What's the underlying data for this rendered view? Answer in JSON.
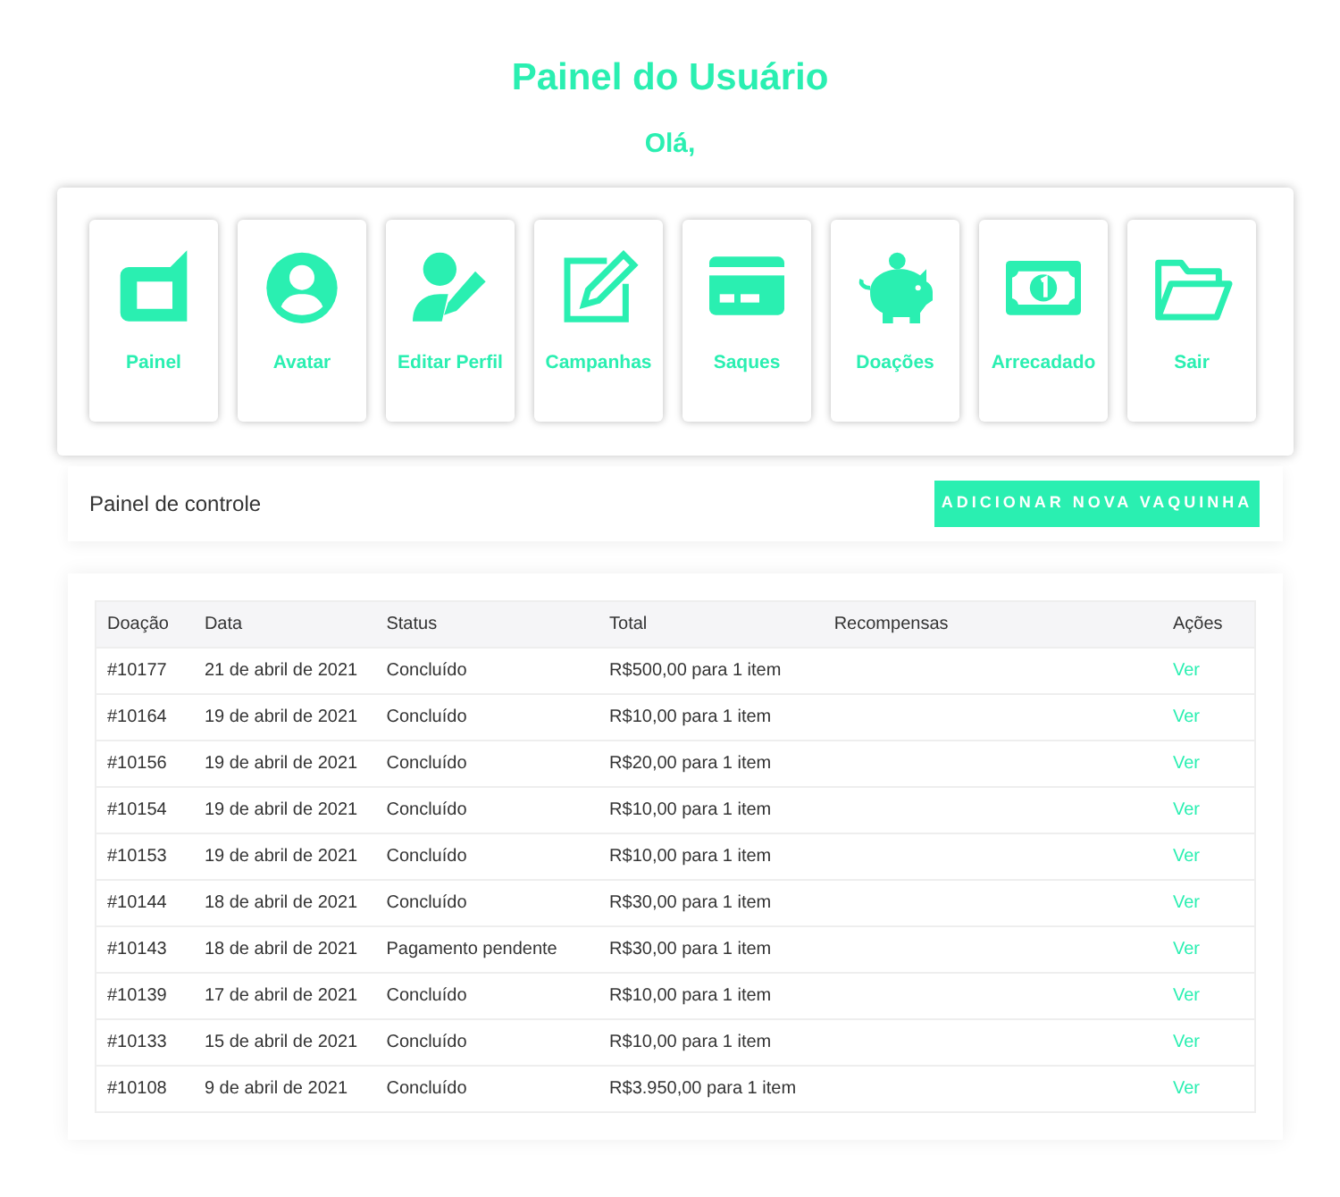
{
  "title": "Painel do Usuário",
  "greeting": "Olá,",
  "menu": [
    {
      "label": "Painel",
      "kind": "chat"
    },
    {
      "label": "Avatar",
      "kind": "avatar"
    },
    {
      "label": "Editar Perfil",
      "kind": "user-edit"
    },
    {
      "label": "Campanhas",
      "kind": "edit"
    },
    {
      "label": "Saques",
      "kind": "card"
    },
    {
      "label": "Doações",
      "kind": "piggy"
    },
    {
      "label": "Arrecadado",
      "kind": "money"
    },
    {
      "label": "Sair",
      "kind": "folder"
    }
  ],
  "control_bar": {
    "label": "Painel de controle",
    "button": "ADICIONAR NOVA VAQUINHA"
  },
  "table": {
    "columns": [
      "Doação",
      "Data",
      "Status",
      "Total",
      "Recompensas",
      "Ações"
    ],
    "rows": [
      [
        "#10177",
        "21 de abril de 2021",
        "Concluído",
        "R$500,00 para 1 item",
        "Ver"
      ],
      [
        "#10164",
        "19 de abril de 2021",
        "Concluído",
        "R$10,00 para 1 item",
        "Ver"
      ],
      [
        "#10156",
        "19 de abril de 2021",
        "Concluído",
        "R$20,00 para 1 item",
        "Ver"
      ],
      [
        "#10154",
        "19 de abril de 2021",
        "Concluído",
        "R$10,00 para 1 item",
        "Ver"
      ],
      [
        "#10153",
        "19 de abril de 2021",
        "Concluído",
        "R$10,00 para 1 item",
        "Ver"
      ],
      [
        "#10144",
        "18 de abril de 2021",
        "Concluído",
        "R$30,00 para 1 item",
        "Ver"
      ],
      [
        "#10143",
        "18 de abril de 2021",
        "Pagamento pendente",
        "R$30,00 para 1 item",
        "Ver"
      ],
      [
        "#10139",
        "17 de abril de 2021",
        "Concluído",
        "R$10,00 para 1 item",
        "Ver"
      ],
      [
        "#10133",
        "15 de abril de 2021",
        "Concluído",
        "R$10,00 para 1 item",
        "Ver"
      ],
      [
        "#10108",
        "9 de abril de 2021",
        "Concluído",
        "R$3.950,00 para 1 item",
        "Ver"
      ]
    ]
  }
}
